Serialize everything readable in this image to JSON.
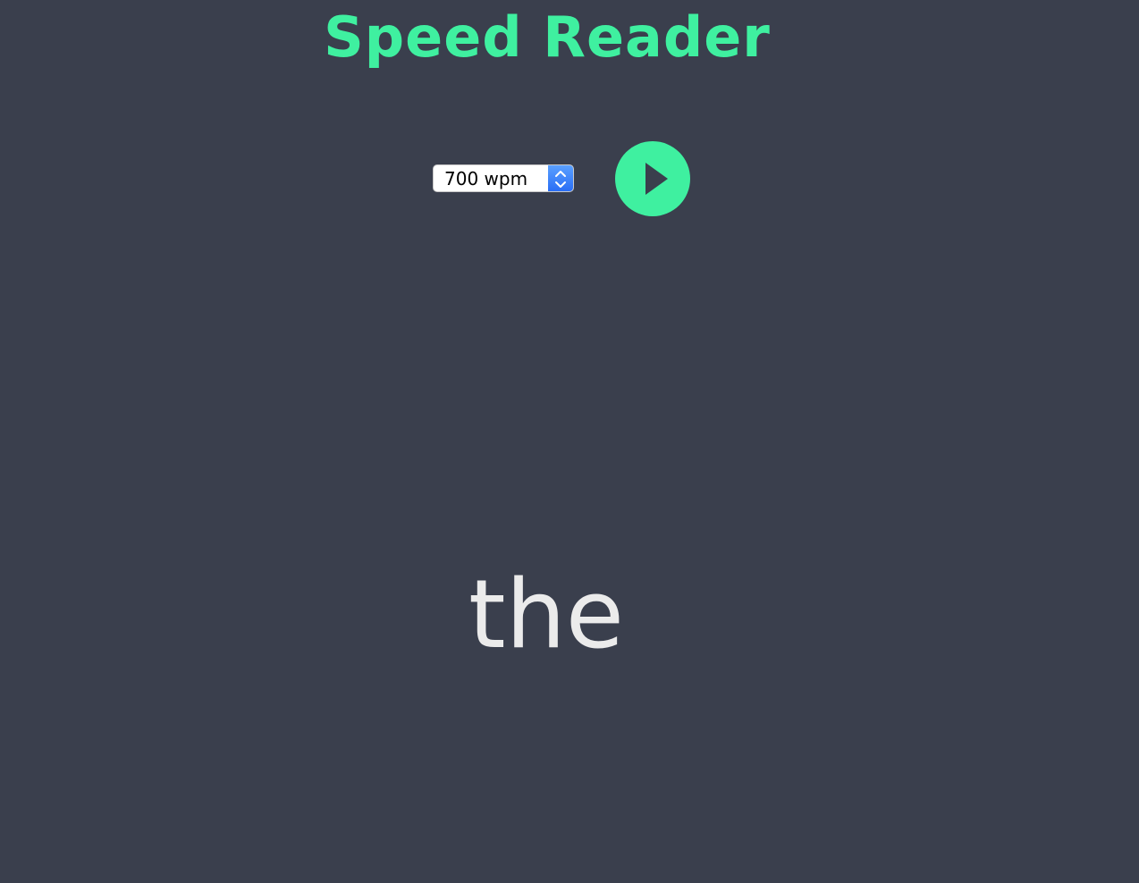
{
  "app": {
    "title": "Speed Reader"
  },
  "controls": {
    "speed_select": {
      "selected_value": "700 wpm"
    },
    "play_button": {
      "icon": "play-icon"
    }
  },
  "reader": {
    "current_word": "the"
  },
  "colors": {
    "background": "#3a3f4d",
    "accent": "#3ff0a0",
    "word_text": "#ebebeb"
  }
}
